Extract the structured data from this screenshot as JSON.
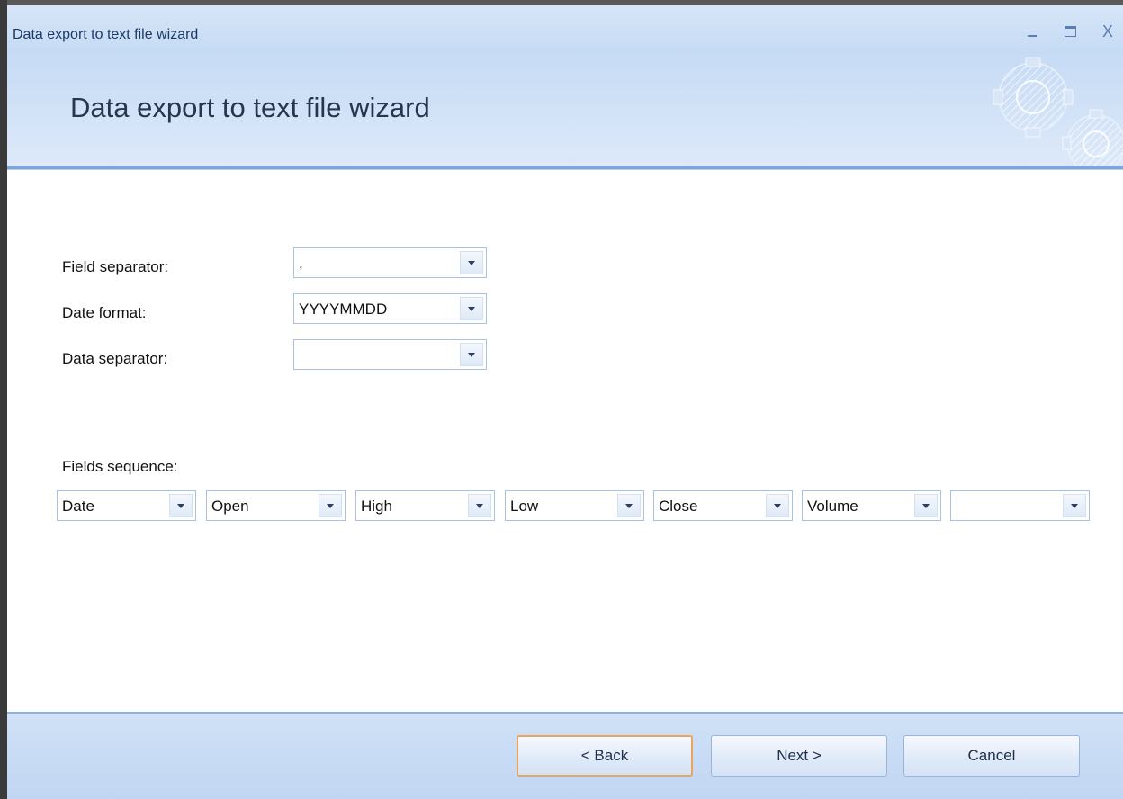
{
  "window": {
    "title": "Data export to text file wizard",
    "controls": {
      "minimize": "_",
      "maximize": "□",
      "close": "X"
    }
  },
  "header": {
    "title": "Data export to text file wizard"
  },
  "form": {
    "field_separator": {
      "label": "Field separator:",
      "value": ","
    },
    "date_format": {
      "label": "Date format:",
      "value": "YYYYMMDD"
    },
    "data_separator": {
      "label": "Data separator:",
      "value": ""
    },
    "fields_sequence": {
      "label": "Fields sequence:",
      "fields": [
        "Date",
        "Open",
        "High",
        "Low",
        "Close",
        "Volume",
        ""
      ]
    }
  },
  "buttons": {
    "back": "<  Back",
    "next": "Next  >",
    "cancel": "Cancel"
  },
  "colors": {
    "accent": "#7fa5da",
    "focus": "#e8a65a",
    "header_bg": "#c6dbf5"
  }
}
